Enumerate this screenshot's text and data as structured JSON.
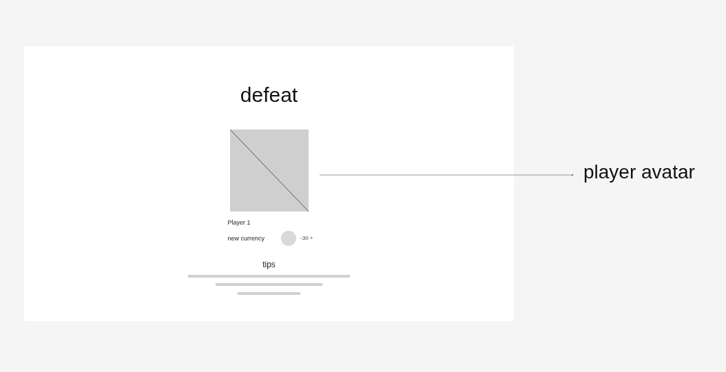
{
  "screen": {
    "title": "defeat",
    "player_name": "Player 1",
    "currency": {
      "label": "new currency",
      "amount": "-30 +"
    },
    "tips": {
      "title": "tips"
    }
  },
  "annotations": [
    {
      "label": "player avatar"
    }
  ]
}
